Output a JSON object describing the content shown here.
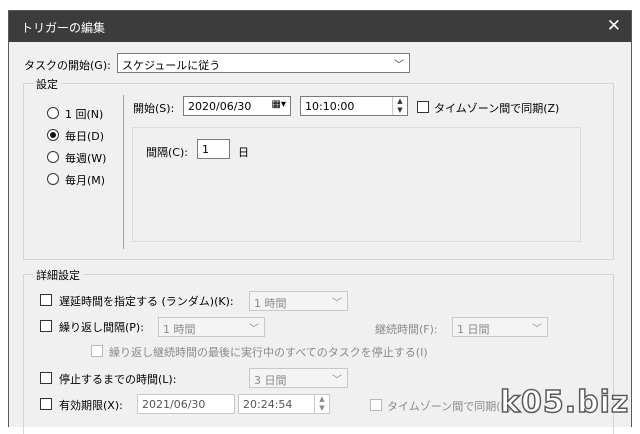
{
  "window": {
    "title": "トリガーの編集",
    "close_glyph": "✕"
  },
  "task_start": {
    "label": "タスクの開始(G):",
    "value": "スケジュールに従う"
  },
  "settings": {
    "group_label": "設定",
    "radios": [
      {
        "label": "1 回(N)",
        "selected": false
      },
      {
        "label": "毎日(D)",
        "selected": true
      },
      {
        "label": "毎週(W)",
        "selected": false
      },
      {
        "label": "毎月(M)",
        "selected": false
      }
    ],
    "start_label": "開始(S):",
    "start_date": "2020/06/30",
    "start_time": "10:10:00",
    "sync_timezone_label": "タイムゾーン間で同期(Z)",
    "interval_label": "間隔(C):",
    "interval_value": "1",
    "interval_unit": "日"
  },
  "advanced": {
    "group_label": "詳細設定",
    "delay_label": "遅延時間を指定する (ランダム)(K):",
    "delay_value": "1 時間",
    "repeat_label": "繰り返し間隔(P):",
    "repeat_value": "1 時間",
    "duration_label": "継続時間(F):",
    "duration_value": "1 日間",
    "stop_all_label": "繰り返し継続時間の最後に実行中のすべてのタスクを停止する(I)",
    "stop_after_label": "停止するまでの時間(L):",
    "stop_after_value": "3 日間",
    "expire_label": "有効期限(X):",
    "expire_date": "2021/06/30",
    "expire_time": "20:24:54",
    "expire_sync_label": "タイムゾーン間で同期(E)"
  },
  "watermark": "k05.biz"
}
